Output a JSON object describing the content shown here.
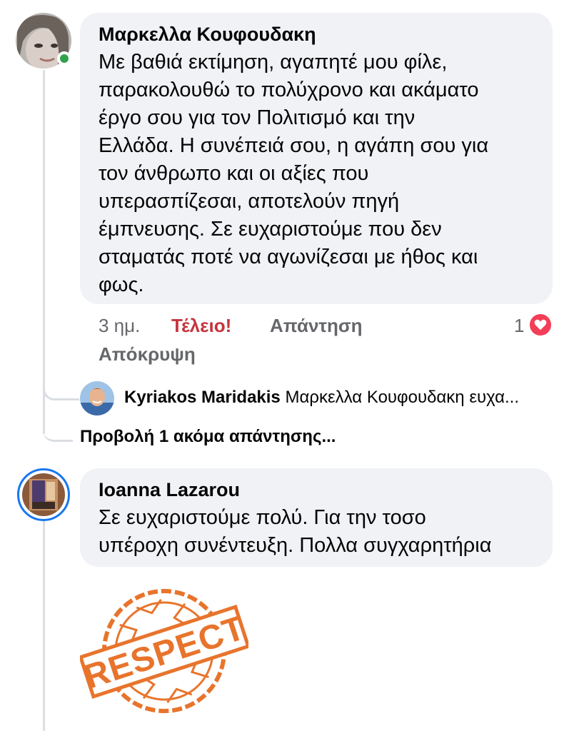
{
  "comments": [
    {
      "author": "Μαρκελλα Κουφουδακη",
      "text_lines": [
        "Με βαθιά εκτίμηση, αγαπητέ μου φίλε,",
        "παρακολουθώ το πολύχρονο και ακάματο",
        "έργο σου για τον Πολιτισμό και την",
        "Ελλάδα. Η συνέπειά σου, η αγάπη σου για",
        "τον άνθρωπο και οι αξίες που",
        "υπερασπίζεσαι, αποτελούν πηγή",
        "έμπνευσης. Σε ευχαριστούμε που δεν",
        "σταματάς ποτέ να αγωνίζεσαι με ήθος και",
        "φως."
      ],
      "time": "3 ημ.",
      "reaction_label": "Τέλειο!",
      "reply_label": "Απάντηση",
      "hide_label": "Απόκρυψη",
      "reaction_count": "1",
      "reaction_icon": "heart-icon",
      "online": true
    },
    {
      "author": "Ioanna Lazarou",
      "text_lines": [
        "Σε ευχαριστούμε πολύ. Για την τοσο",
        "υπέροχη συνέντευξη. Πολλα συγχαρητήρια"
      ],
      "sticker_text": "RESPECT"
    }
  ],
  "reply_preview": {
    "author": "Kyriakos Maridakis",
    "text": "Μαρκελλα Κουφουδακη ευχα..."
  },
  "view_more_replies": "Προβολή 1 ακόμα απάντησης...",
  "colors": {
    "bubble": "#f0f2f5",
    "reaction": "#c4353d",
    "secondary_text": "#65676b",
    "online": "#31a24c",
    "heart": "#f33e58",
    "sticker": "#e8742c",
    "story_ring": "#1877f2"
  }
}
